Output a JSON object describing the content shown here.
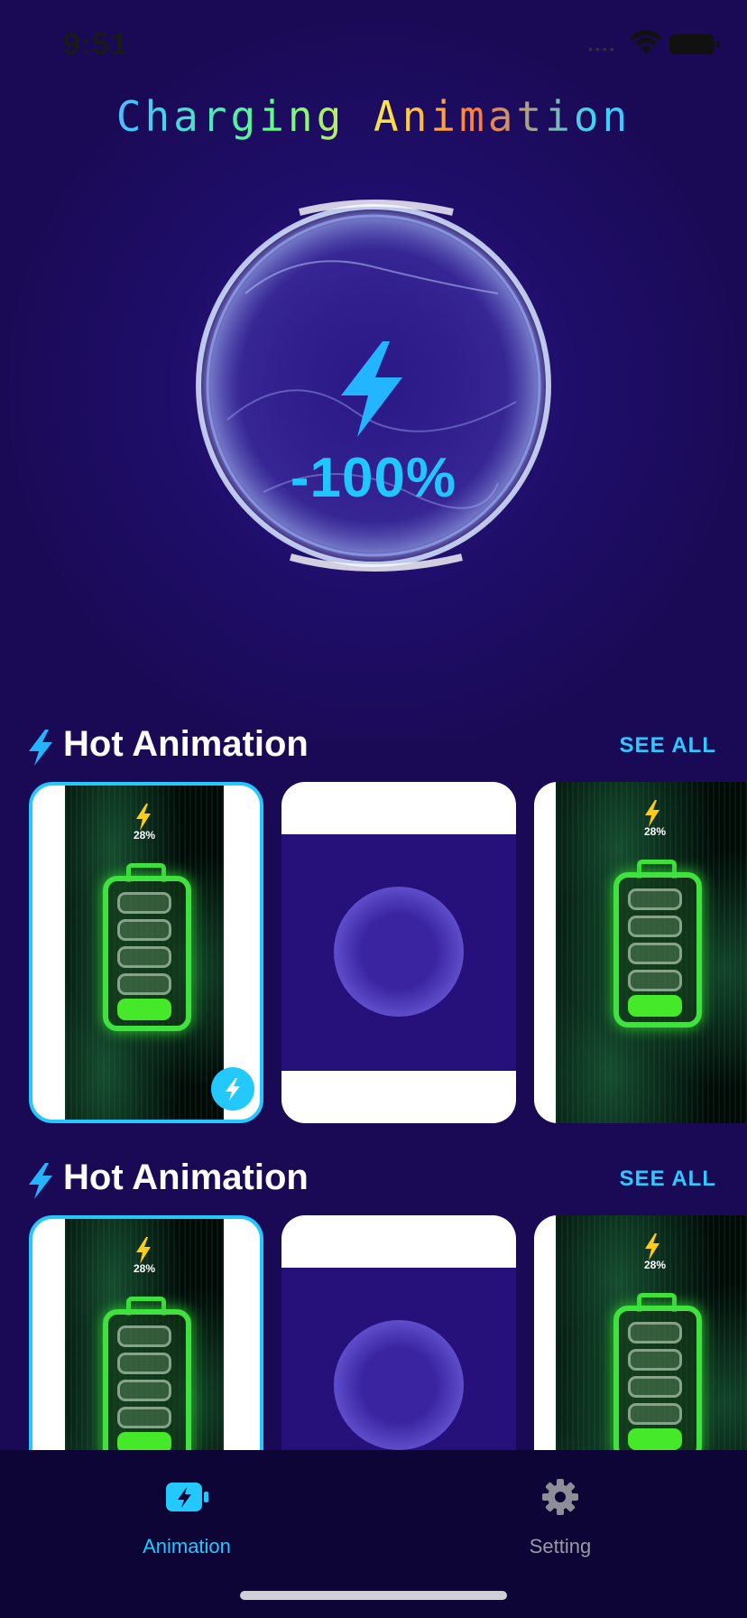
{
  "status_bar": {
    "time": "9:51"
  },
  "header": {
    "title": "Charging Animation"
  },
  "hero": {
    "percent_text": "-100%"
  },
  "sections": [
    {
      "title": "Hot Animation",
      "see_all": "SEE ALL"
    },
    {
      "title": "Hot Animation",
      "see_all": "SEE ALL"
    }
  ],
  "cards": {
    "battery_percent": "28%"
  },
  "tabs": [
    {
      "label": "Animation",
      "icon": "battery-bolt-icon",
      "active": true
    },
    {
      "label": "Setting",
      "icon": "gear-icon",
      "active": false
    }
  ],
  "colors": {
    "background": "#1a0a55",
    "accent": "#23c8ff",
    "battery_green": "#3fe23f",
    "tab_bar": "#0c0536",
    "tab_inactive": "#9a9aa6"
  }
}
